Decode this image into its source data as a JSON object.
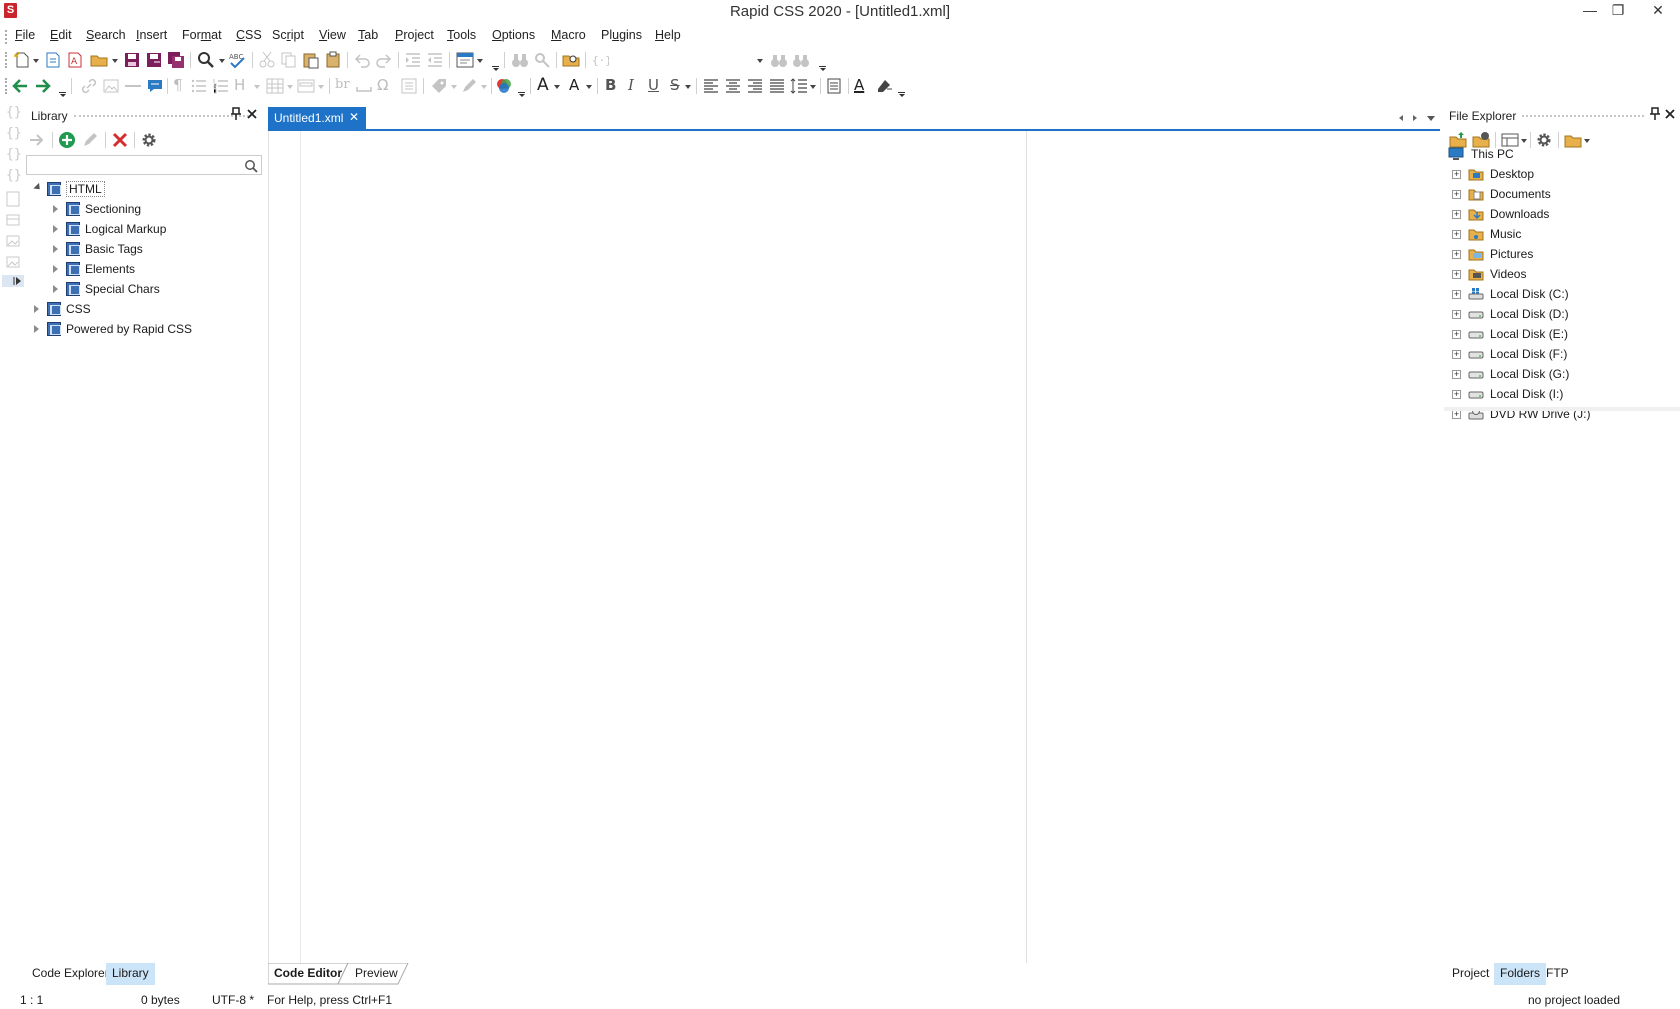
{
  "window": {
    "app_letter": "S",
    "title": "Rapid CSS 2020 - [Untitled1.xml]",
    "minimize": "—",
    "restore": "❐",
    "close": "✕"
  },
  "menu": [
    {
      "label": "File",
      "ul": "F",
      "rest": "ile"
    },
    {
      "label": "Edit",
      "ul": "E",
      "rest": "dit"
    },
    {
      "label": "Search",
      "ul": "S",
      "rest": "earch"
    },
    {
      "label": "Insert",
      "ul": "I",
      "rest": "nsert"
    },
    {
      "label": "Format",
      "pre": "For",
      "ul": "m",
      "rest": "at"
    },
    {
      "label": "CSS",
      "ul": "C",
      "rest": "SS"
    },
    {
      "label": "Script",
      "pre": "Sc",
      "ul": "r",
      "rest": "ipt"
    },
    {
      "label": "View",
      "ul": "V",
      "rest": "iew"
    },
    {
      "label": "Tab",
      "ul": "T",
      "rest": "ab"
    },
    {
      "label": "Project",
      "ul": "P",
      "rest": "roject"
    },
    {
      "label": "Tools",
      "ul": "T",
      "rest": "ools"
    },
    {
      "label": "Options",
      "ul": "O",
      "rest": "ptions"
    },
    {
      "label": "Macro",
      "ul": "M",
      "rest": "acro"
    },
    {
      "label": "Plugins",
      "pre": "Pl",
      "ul": "u",
      "rest": "gins"
    },
    {
      "label": "Help",
      "ul": "H",
      "rest": "elp"
    }
  ],
  "toolbar2_glyphs": {
    "br": "br",
    "omega": "Ω",
    "font_a": "A",
    "bold": "B",
    "italic": "I",
    "underline": "U",
    "strike": "S"
  },
  "library": {
    "title": "Library",
    "search_placeholder": "",
    "tree": [
      {
        "label": "HTML",
        "level": 0,
        "expanded": true
      },
      {
        "label": "Sectioning",
        "level": 1,
        "expanded": false
      },
      {
        "label": "Logical Markup",
        "level": 1,
        "expanded": false
      },
      {
        "label": "Basic Tags",
        "level": 1,
        "expanded": false
      },
      {
        "label": "Elements",
        "level": 1,
        "expanded": false
      },
      {
        "label": "Special Chars",
        "level": 1,
        "expanded": false
      },
      {
        "label": "CSS",
        "level": 0,
        "expanded": false
      },
      {
        "label": "Powered by Rapid CSS",
        "level": 0,
        "expanded": false
      }
    ],
    "bottom_tabs": [
      "Code Explorer",
      "Library"
    ],
    "active_bottom_tab": "Library"
  },
  "editor": {
    "tab_label": "Untitled1.xml",
    "tab_close": "✕",
    "bottom_tabs": [
      "Code Editor",
      "Preview"
    ],
    "active_bottom_tab": "Code Editor"
  },
  "explorer": {
    "title": "File Explorer",
    "root": "This PC",
    "items": [
      {
        "label": "Desktop",
        "icon": "desktop-folder-icon"
      },
      {
        "label": "Documents",
        "icon": "documents-folder-icon"
      },
      {
        "label": "Downloads",
        "icon": "downloads-folder-icon"
      },
      {
        "label": "Music",
        "icon": "music-folder-icon"
      },
      {
        "label": "Pictures",
        "icon": "pictures-folder-icon"
      },
      {
        "label": "Videos",
        "icon": "videos-folder-icon"
      },
      {
        "label": "Local Disk (C:)",
        "icon": "system-drive-icon"
      },
      {
        "label": "Local Disk (D:)",
        "icon": "hard-drive-icon"
      },
      {
        "label": "Local Disk (E:)",
        "icon": "hard-drive-icon"
      },
      {
        "label": "Local Disk (F:)",
        "icon": "hard-drive-icon"
      },
      {
        "label": "Local Disk (G:)",
        "icon": "hard-drive-icon"
      },
      {
        "label": "Local Disk (I:)",
        "icon": "hard-drive-icon"
      },
      {
        "label": "DVD RW Drive (J:)",
        "icon": "dvd-drive-icon"
      }
    ],
    "bottom_tabs": [
      "Project",
      "Folders",
      "FTP"
    ],
    "active_bottom_tab": "Folders"
  },
  "status": {
    "position": "1 : 1",
    "size": "0 bytes",
    "encoding": "UTF-8 *",
    "help": "For Help, press Ctrl+F1",
    "project": "no project loaded"
  },
  "colors": {
    "accent": "#1e73c8",
    "active_bottom_tab": "#cce4f7",
    "app_icon": "#c8252c"
  }
}
